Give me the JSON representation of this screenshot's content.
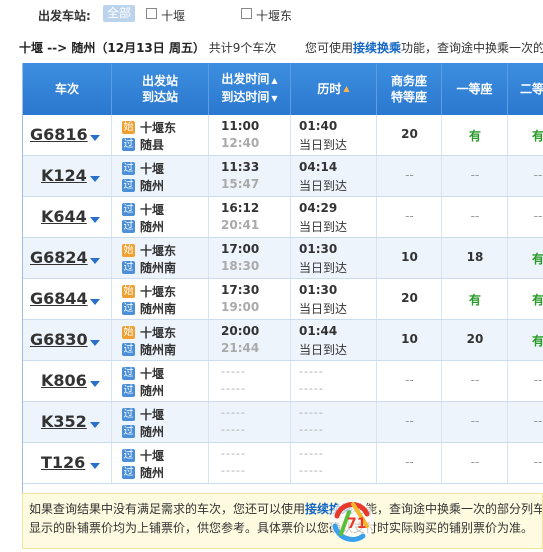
{
  "filter": {
    "label": "出发车站:",
    "all_label": "全部",
    "options": [
      "十堰",
      "十堰东"
    ]
  },
  "summary": {
    "route": "十堰 --> 随州（12月13日 周五）",
    "count": "共计9个车次",
    "tip_prefix": "您可使用",
    "tip_link": "接续换乘",
    "tip_suffix": "功能，查询途中换乘一次的"
  },
  "columns": {
    "train": "车次",
    "station_1": "出发站",
    "station_2": "到达站",
    "time_1": "出发时间",
    "time_2": "到达时间",
    "duration": "历时",
    "business_1": "商务座",
    "business_2": "特等座",
    "first": "一等座",
    "second": "二等"
  },
  "badges": {
    "start": "始",
    "pass": "过"
  },
  "trains": [
    {
      "no": "G6816",
      "from_badge": "start",
      "from": "十堰东",
      "to_badge": "pass",
      "to": "随县",
      "dep": "11:00",
      "arr": "12:40",
      "dur": "01:40",
      "note": "当日到达",
      "business": "20",
      "first": "有",
      "second": "有"
    },
    {
      "no": "K124",
      "from_badge": "pass",
      "from": "十堰",
      "to_badge": "pass",
      "to": "随州",
      "dep": "11:33",
      "arr": "15:47",
      "dur": "04:14",
      "note": "当日到达",
      "business": "--",
      "first": "--",
      "second": "--"
    },
    {
      "no": "K644",
      "from_badge": "pass",
      "from": "十堰",
      "to_badge": "pass",
      "to": "随州",
      "dep": "16:12",
      "arr": "20:41",
      "dur": "04:29",
      "note": "当日到达",
      "business": "--",
      "first": "--",
      "second": "--"
    },
    {
      "no": "G6824",
      "from_badge": "start",
      "from": "十堰东",
      "to_badge": "pass",
      "to": "随州南",
      "dep": "17:00",
      "arr": "18:30",
      "dur": "01:30",
      "note": "当日到达",
      "business": "10",
      "first": "18",
      "second": "有"
    },
    {
      "no": "G6844",
      "from_badge": "start",
      "from": "十堰东",
      "to_badge": "pass",
      "to": "随州南",
      "dep": "17:30",
      "arr": "19:00",
      "dur": "01:30",
      "note": "当日到达",
      "business": "20",
      "first": "有",
      "second": "有"
    },
    {
      "no": "G6830",
      "from_badge": "start",
      "from": "十堰东",
      "to_badge": "pass",
      "to": "随州南",
      "dep": "20:00",
      "arr": "21:44",
      "dur": "01:44",
      "note": "当日到达",
      "business": "10",
      "first": "20",
      "second": "有"
    },
    {
      "no": "K806",
      "from_badge": "pass",
      "from": "十堰",
      "to_badge": "pass",
      "to": "随州",
      "dep": "-----",
      "arr": "-----",
      "dur": "-----",
      "note": "-----",
      "business": "--",
      "first": "--",
      "second": "--"
    },
    {
      "no": "K352",
      "from_badge": "pass",
      "from": "十堰",
      "to_badge": "pass",
      "to": "随州",
      "dep": "-----",
      "arr": "-----",
      "dur": "-----",
      "note": "-----",
      "business": "--",
      "first": "--",
      "second": "--"
    },
    {
      "no": "T126",
      "from_badge": "pass",
      "from": "十堰",
      "to_badge": "pass",
      "to": "随州",
      "dep": "-----",
      "arr": "-----",
      "dur": "-----",
      "note": "-----",
      "business": "--",
      "first": "--",
      "second": "--"
    }
  ],
  "notice": {
    "line1_a": "如果查询结果中没有满足需求的车次，您还可以使用",
    "line1_link": "接续换乘",
    "line1_b": "功能，查询途中换乘一次的部分列车",
    "line2": "显示的卧铺票价均为上铺票价，供您参考。具体票价以您确认支付时实际购买的铺别票价为准。"
  },
  "colors": {
    "header_blue": "#2a78cf",
    "available_green": "#2a9a2a",
    "link_blue": "#1567c3",
    "start_badge": "#f0a030",
    "pass_badge": "#4a8fd8"
  }
}
